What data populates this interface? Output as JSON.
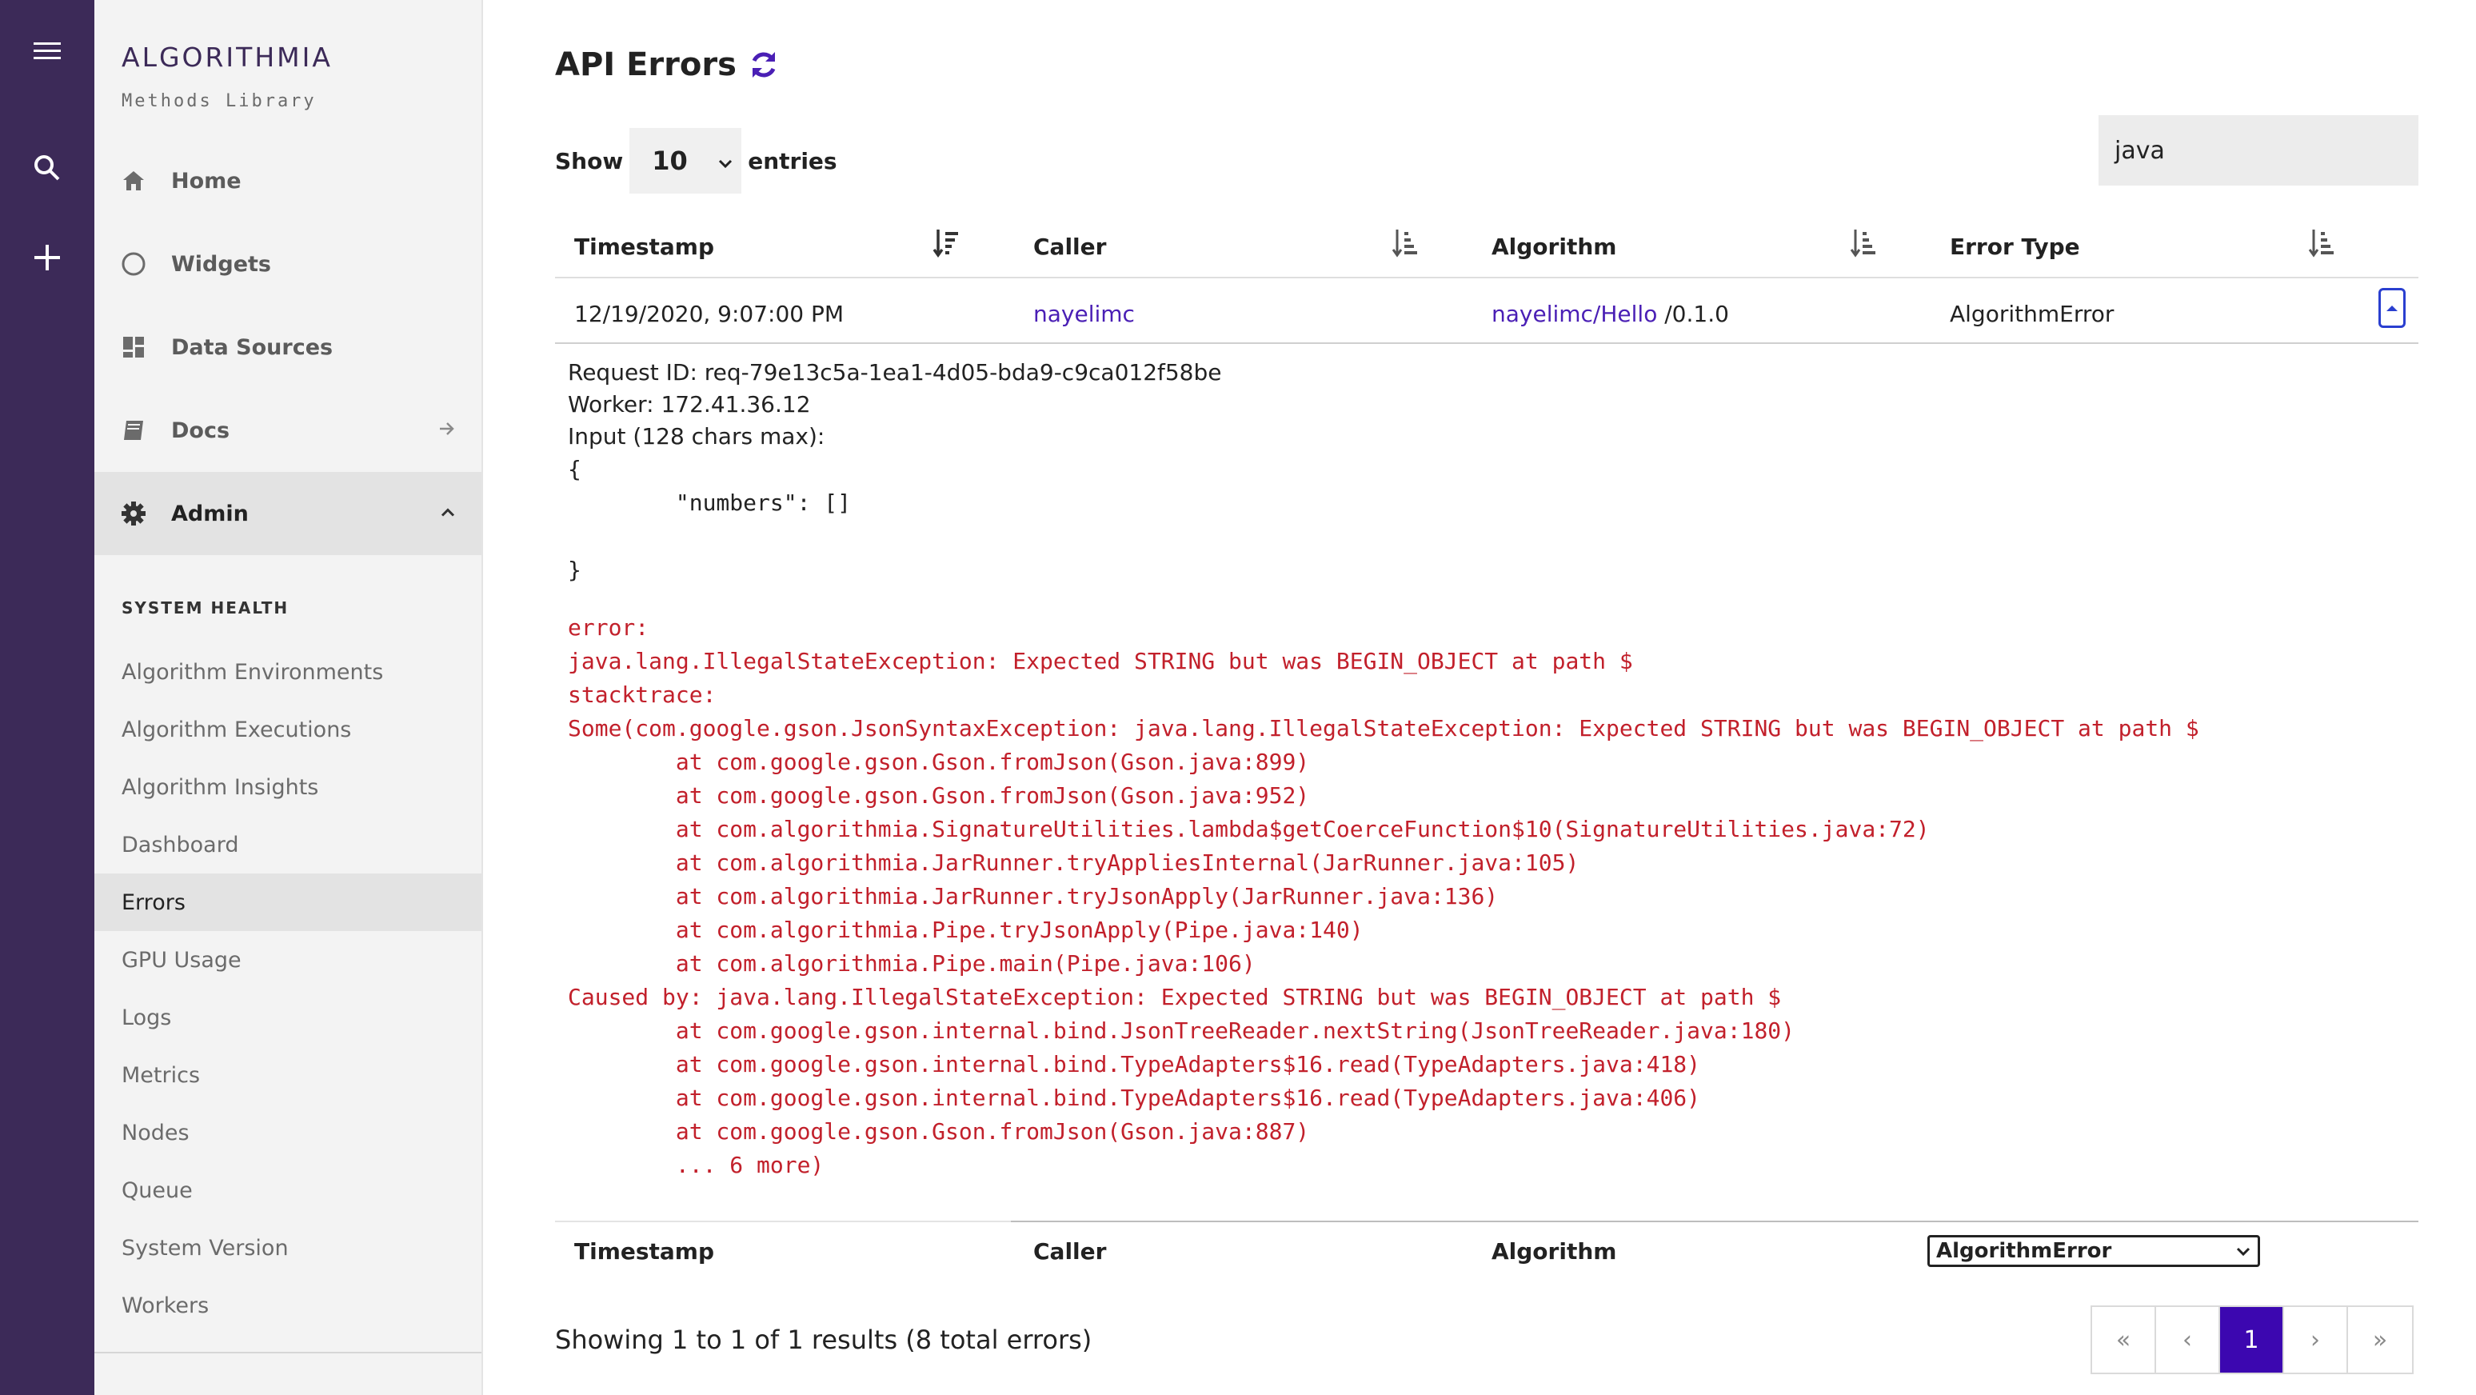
{
  "rail": {
    "items": [
      "menu-icon",
      "search-icon",
      "plus-icon"
    ]
  },
  "sidebar": {
    "logo": "ALGORITHMIA",
    "subtitle": "Methods Library",
    "nav": [
      {
        "label": "Home",
        "icon": "home-icon"
      },
      {
        "label": "Widgets",
        "icon": "circle-icon"
      },
      {
        "label": "Data Sources",
        "icon": "grid-icon"
      },
      {
        "label": "Docs",
        "icon": "book-icon"
      },
      {
        "label": "Admin",
        "icon": "gear-icon"
      }
    ],
    "section_title": "SYSTEM HEALTH",
    "sub_items": [
      "Algorithm Environments",
      "Algorithm Executions",
      "Algorithm Insights",
      "Dashboard",
      "Errors",
      "GPU Usage",
      "Logs",
      "Metrics",
      "Nodes",
      "Queue",
      "System Version",
      "Workers"
    ],
    "active_sub": "Errors"
  },
  "main": {
    "title": "API Errors",
    "show_label": "Show",
    "entries_value": "10",
    "entries_label": "entries",
    "search_value": "java",
    "columns": [
      "Timestamp",
      "Caller",
      "Algorithm",
      "Error Type"
    ],
    "row": {
      "timestamp": "12/19/2020, 9:07:00 PM",
      "caller": "nayelimc",
      "algorithm_link": "nayelimc/Hello",
      "algorithm_version": " /0.1.0",
      "error_type": "AlgorithmError"
    },
    "detail": {
      "request_id": "Request ID: req-79e13c5a-1ea1-4d05-bda9-c9ca012f58be",
      "worker": "Worker: 172.41.36.12",
      "input_label": "Input (128 chars max):",
      "input_body": "{\n        \"numbers\": []\n\n}",
      "error_text": "error:\njava.lang.IllegalStateException: Expected STRING but was BEGIN_OBJECT at path $\nstacktrace:\nSome(com.google.gson.JsonSyntaxException: java.lang.IllegalStateException: Expected STRING but was BEGIN_OBJECT at path $\n        at com.google.gson.Gson.fromJson(Gson.java:899)\n        at com.google.gson.Gson.fromJson(Gson.java:952)\n        at com.algorithmia.SignatureUtilities.lambda$getCoerceFunction$10(SignatureUtilities.java:72)\n        at com.algorithmia.JarRunner.tryAppliesInternal(JarRunner.java:105)\n        at com.algorithmia.JarRunner.tryJsonApply(JarRunner.java:136)\n        at com.algorithmia.Pipe.tryJsonApply(Pipe.java:140)\n        at com.algorithmia.Pipe.main(Pipe.java:106)\nCaused by: java.lang.IllegalStateException: Expected STRING but was BEGIN_OBJECT at path $\n        at com.google.gson.internal.bind.JsonTreeReader.nextString(JsonTreeReader.java:180)\n        at com.google.gson.internal.bind.TypeAdapters$16.read(TypeAdapters.java:418)\n        at com.google.gson.internal.bind.TypeAdapters$16.read(TypeAdapters.java:406)\n        at com.google.gson.Gson.fromJson(Gson.java:887)\n        ... 6 more)"
    },
    "footer_columns": [
      "Timestamp",
      "Caller",
      "Algorithm"
    ],
    "error_type_filter": "AlgorithmError",
    "showing_text": "Showing 1 to 1 of 1 results (8 total errors)",
    "pagination": {
      "first": "«",
      "prev": "‹",
      "current": "1",
      "next": "›",
      "last": "»"
    },
    "colors": {
      "accent": "#3c07b0",
      "rail": "#3c2a58",
      "error": "#c2202b",
      "link": "#4a1fb5"
    }
  }
}
